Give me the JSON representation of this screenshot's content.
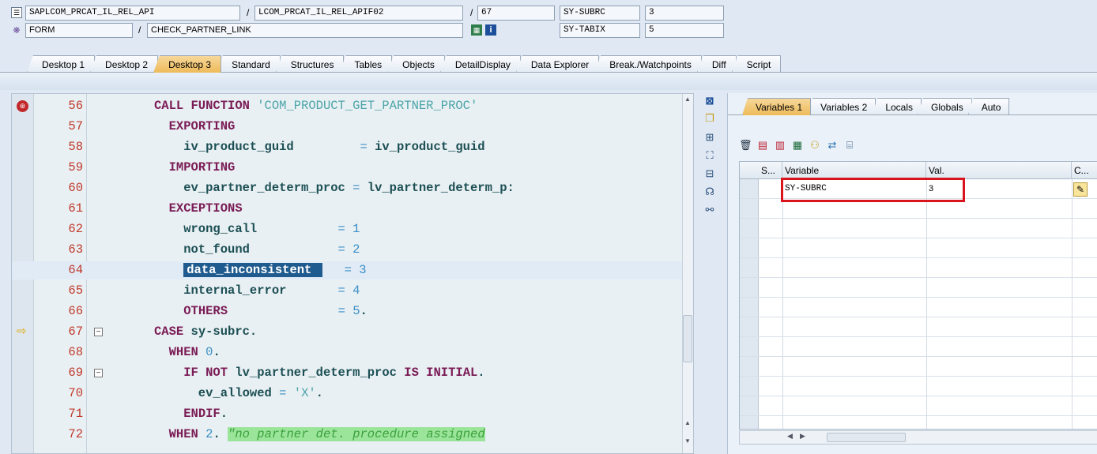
{
  "header": {
    "program": "SAPLCOM_PRCAT_IL_REL_API",
    "include": "LCOM_PRCAT_IL_REL_APIF02",
    "line": "67",
    "var1_name": "SY-SUBRC",
    "var1_value": "3",
    "event_type": "FORM",
    "event_name": "CHECK_PARTNER_LINK",
    "var2_name": "SY-TABIX",
    "var2_value": "5",
    "sep": "/"
  },
  "desktop_tabs": [
    {
      "label": "Desktop 1"
    },
    {
      "label": "Desktop 2"
    },
    {
      "label": "Desktop 3",
      "active": true
    },
    {
      "label": "Standard"
    },
    {
      "label": "Structures"
    },
    {
      "label": "Tables"
    },
    {
      "label": "Objects"
    },
    {
      "label": "DetailDisplay"
    },
    {
      "label": "Data Explorer"
    },
    {
      "label": "Break./Watchpoints"
    },
    {
      "label": "Diff"
    },
    {
      "label": "Script"
    }
  ],
  "code": {
    "current_line": "67",
    "lines": [
      {
        "n": "56",
        "text": "CALL FUNCTION 'COM_PRODUCT_GET_PARTNER_PROC'"
      },
      {
        "n": "57",
        "text": "  EXPORTING"
      },
      {
        "n": "58",
        "text": "    iv_product_guid         = iv_product_guid"
      },
      {
        "n": "59",
        "text": "  IMPORTING"
      },
      {
        "n": "60",
        "text": "    ev_partner_determ_proc = lv_partner_determ_p:"
      },
      {
        "n": "61",
        "text": "  EXCEPTIONS"
      },
      {
        "n": "62",
        "text": "    wrong_call           = 1"
      },
      {
        "n": "63",
        "text": "    not_found            = 2"
      },
      {
        "n": "64",
        "text": "    data_inconsistent    = 3"
      },
      {
        "n": "65",
        "text": "    internal_error       = 4"
      },
      {
        "n": "66",
        "text": "    OTHERS               = 5."
      },
      {
        "n": "67",
        "text": "CASE sy-subrc."
      },
      {
        "n": "68",
        "text": "  WHEN 0."
      },
      {
        "n": "69",
        "text": "    IF NOT lv_partner_determ_proc IS INITIAL."
      },
      {
        "n": "70",
        "text": "      ev_allowed = 'X'."
      },
      {
        "n": "71",
        "text": "    ENDIF."
      },
      {
        "n": "72",
        "text": "  WHEN 2. \"no partner det. procedure assigned"
      }
    ]
  },
  "var_tabs": [
    {
      "label": "Variables 1",
      "active": true
    },
    {
      "label": "Variables 2"
    },
    {
      "label": "Locals"
    },
    {
      "label": "Globals"
    },
    {
      "label": "Auto"
    }
  ],
  "var_grid": {
    "columns": [
      "S...",
      "Variable",
      "Val.",
      "C..."
    ],
    "rows": [
      {
        "variable": "SY-SUBRC",
        "value": "3"
      }
    ]
  },
  "icons": {
    "breakpoint": "session-breakpoint-icon",
    "current_line": "arrow-right-icon",
    "colors": {
      "line_numbers": "#c0392b",
      "keyword": "#7a1b55",
      "active_tab": "#eebb5a",
      "highlight_box": "#d9141c"
    }
  }
}
